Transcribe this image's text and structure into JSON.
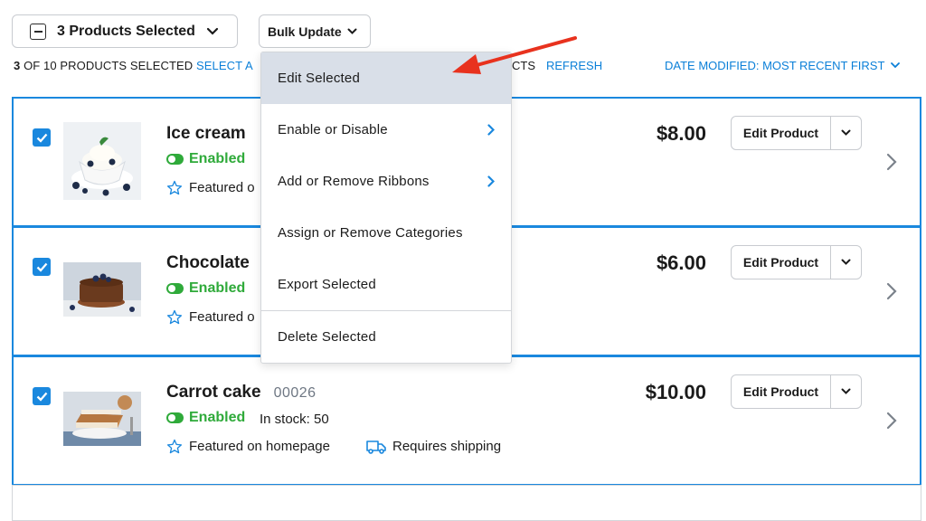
{
  "toolbar": {
    "selection_label": "3 Products Selected",
    "bulk_label": "Bulk Update"
  },
  "status_line": {
    "count_bold": "3",
    "count_text": "OF 10 PRODUCTS SELECTED",
    "select_all_fragment": "SELECT A",
    "hidden_fragment": "CTS",
    "refresh": "REFRESH",
    "sort": "DATE MODIFIED: MOST RECENT FIRST"
  },
  "bulk_menu": {
    "items": [
      {
        "label": "Edit Selected",
        "active": true,
        "submenu": false
      },
      {
        "label": "Enable or Disable",
        "submenu": true
      },
      {
        "label": "Add or Remove Ribbons",
        "submenu": true
      },
      {
        "label": "Assign or Remove Categories",
        "submenu": false
      },
      {
        "label": "Export Selected",
        "submenu": false
      },
      {
        "label": "Delete Selected",
        "submenu": false
      }
    ]
  },
  "products": [
    {
      "name": "Ice cream",
      "sku": "",
      "status": "Enabled",
      "stock": "",
      "featured": "Featured o",
      "shipping": "",
      "price": "$8.00",
      "edit": "Edit Product",
      "checked": true
    },
    {
      "name": "Chocolate",
      "sku": "",
      "status": "Enabled",
      "stock": "",
      "featured": "Featured o",
      "shipping": "",
      "price": "$6.00",
      "edit": "Edit Product",
      "checked": true
    },
    {
      "name": "Carrot cake",
      "sku": "00026",
      "status": "Enabled",
      "stock": "In stock: 50",
      "featured": "Featured on homepage",
      "shipping": "Requires shipping",
      "price": "$10.00",
      "edit": "Edit Product",
      "checked": true
    }
  ],
  "colors": {
    "accent": "#1a88de",
    "link": "#0a7fd8",
    "enabled": "#2faa3a",
    "menu_highlight": "#d9dfe8",
    "annotation_arrow": "#e8321e"
  }
}
